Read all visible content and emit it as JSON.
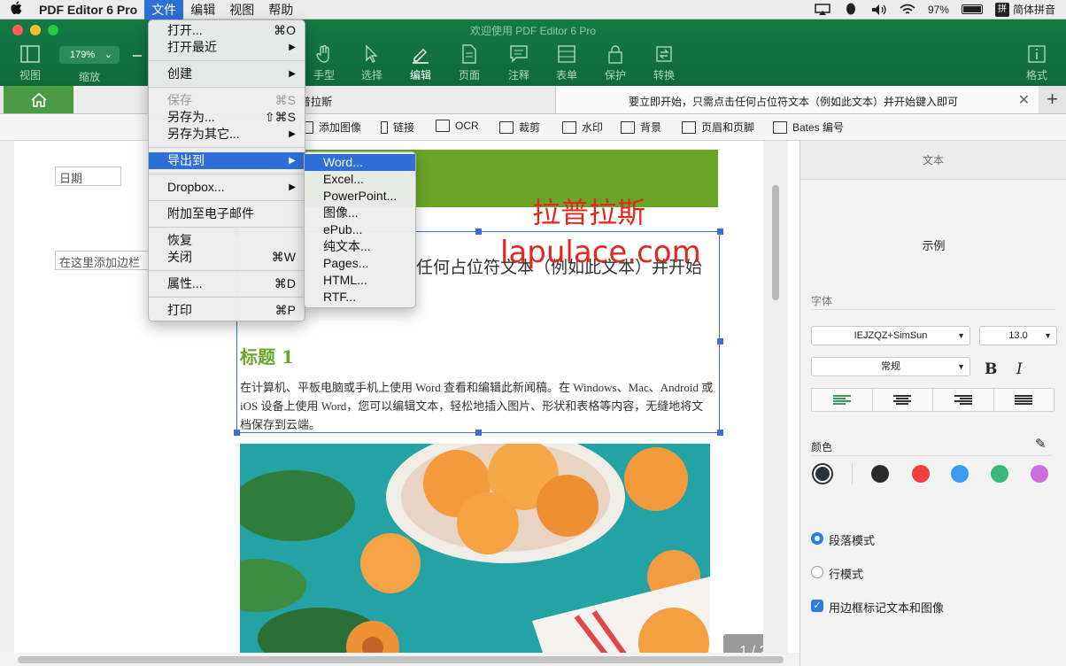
{
  "menubar": {
    "app_name": "PDF Editor 6 Pro",
    "items": [
      "文件",
      "编辑",
      "视图",
      "帮助"
    ],
    "status": {
      "battery": "97%",
      "ime": "简体拼音",
      "ime_glyph": "拼"
    }
  },
  "window": {
    "title": "欢迎使用 PDF Editor 6 Pro",
    "zoom": "179%"
  },
  "toolbar": {
    "view": "视图",
    "zoom": "缩放",
    "hand": "手型",
    "select": "选择",
    "edit": "编辑",
    "page": "页面",
    "annotate": "注释",
    "form": "表单",
    "protect": "保护",
    "convert": "转换",
    "format": "格式"
  },
  "tabs": {
    "doc1": "普拉斯",
    "doc2": "要立即开始，只需点击任何占位符文本（例如此文本）并开始键入即可"
  },
  "editbar": {
    "add_image": "添加图像",
    "link": "链接",
    "ocr": "OCR",
    "crop": "裁剪",
    "watermark": "水印",
    "background": "背景",
    "header_footer": "页眉和页脚",
    "bates": "Bates 编号"
  },
  "document": {
    "date_field": "日期",
    "sidebar_field": "在这里添加边栏",
    "watermark_cn": "拉普拉斯",
    "watermark_url": "lapulace.com",
    "placeholder_line": "任何占位符文本（例如此文本）并开始",
    "heading": "标题 1",
    "body": "在计算机、平板电脑或手机上使用 Word 查看和编辑此新闻稿。在 Windows、Mac、Android 或 iOS 设备上使用 Word，您可以编辑文本，轻松地插入图片、形状和表格等内容，无缝地将文档保存到云端。",
    "page_indicator": "1 / 2"
  },
  "right_panel": {
    "tab": "文本",
    "sample": "示例",
    "font_label": "字体",
    "font_name": "IEJZQZ+SimSun",
    "font_size": "13.0",
    "font_style": "常规",
    "bold": "B",
    "italic": "I",
    "color_label": "颜色",
    "colors": [
      "#2b303b",
      "#2b2b2b",
      "#f04040",
      "#3a9af0",
      "#3ab97a",
      "#c96fe0"
    ],
    "paragraph_mode": "段落模式",
    "line_mode": "行模式",
    "mark_boxes": "用边框标记文本和图像"
  },
  "file_menu": {
    "open": "打开...",
    "open_sc": "⌘O",
    "open_recent": "打开最近",
    "create": "创建",
    "save": "保存",
    "save_sc": "⌘S",
    "save_as": "另存为...",
    "save_as_sc": "⇧⌘S",
    "save_as_other": "另存为其它...",
    "export": "导出到",
    "dropbox": "Dropbox...",
    "attach_email": "附加至电子邮件",
    "revert": "恢复",
    "close": "关闭",
    "close_sc": "⌘W",
    "properties": "属性...",
    "properties_sc": "⌘D",
    "print": "打印",
    "print_sc": "⌘P"
  },
  "export_menu": {
    "items": [
      "Word...",
      "Excel...",
      "PowerPoint...",
      "图像...",
      "ePub...",
      "纯文本...",
      "Pages...",
      "HTML...",
      "RTF..."
    ]
  }
}
